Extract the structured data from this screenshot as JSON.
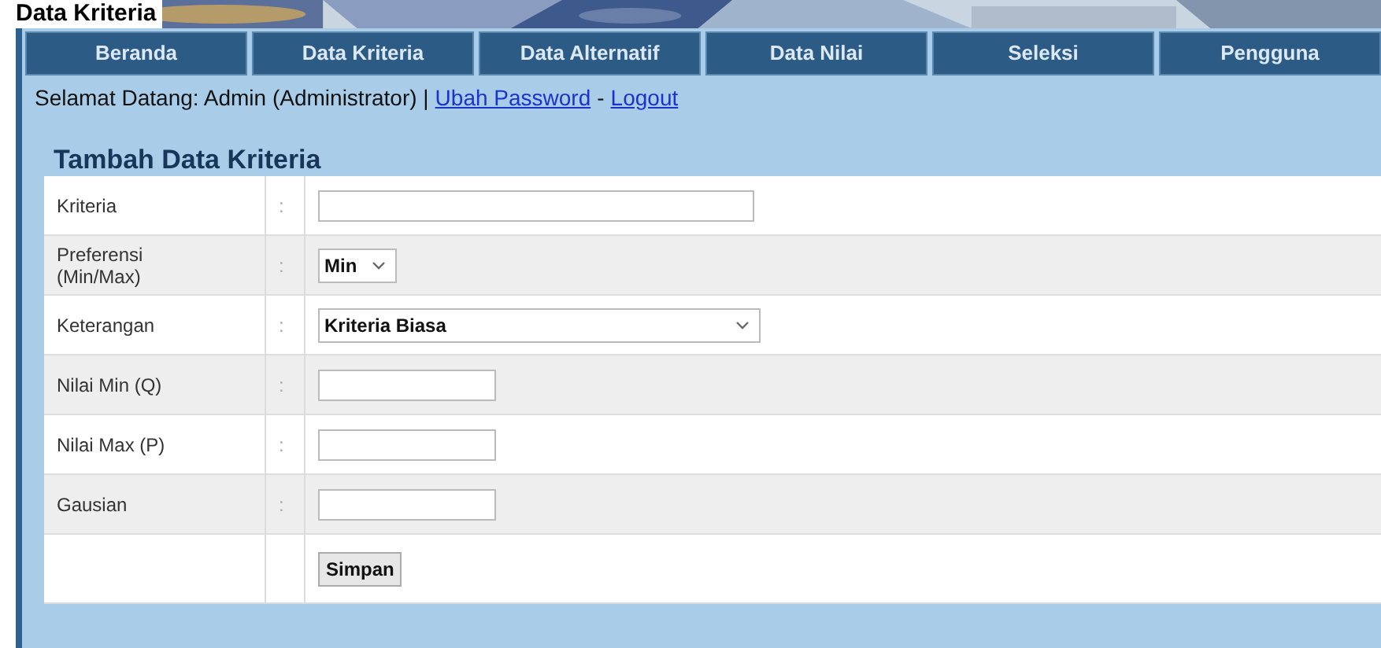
{
  "caption": "Data Kriteria",
  "nav": [
    "Beranda",
    "Data Kriteria",
    "Data Alternatif",
    "Data Nilai",
    "Seleksi",
    "Pengguna"
  ],
  "welcome": {
    "text": "Selamat Datang: Admin (Administrator) |",
    "link1": "Ubah Password",
    "sep": "-",
    "link2": "Logout"
  },
  "heading": "Tambah Data Kriteria",
  "rows": [
    {
      "label": "Kriteria",
      "colon": ":",
      "kind": "text"
    },
    {
      "label": "Preferensi (Min/Max)",
      "colon": ":",
      "kind": "select",
      "value": "Min"
    },
    {
      "label": "Keterangan",
      "colon": ":",
      "kind": "select",
      "value": "Kriteria Biasa"
    },
    {
      "label": "Nilai Min (Q)",
      "colon": ":",
      "kind": "text"
    },
    {
      "label": "Nilai Max (P)",
      "colon": ":",
      "kind": "text"
    },
    {
      "label": "Gausian",
      "colon": ":",
      "kind": "text"
    }
  ],
  "button": "Simpan"
}
